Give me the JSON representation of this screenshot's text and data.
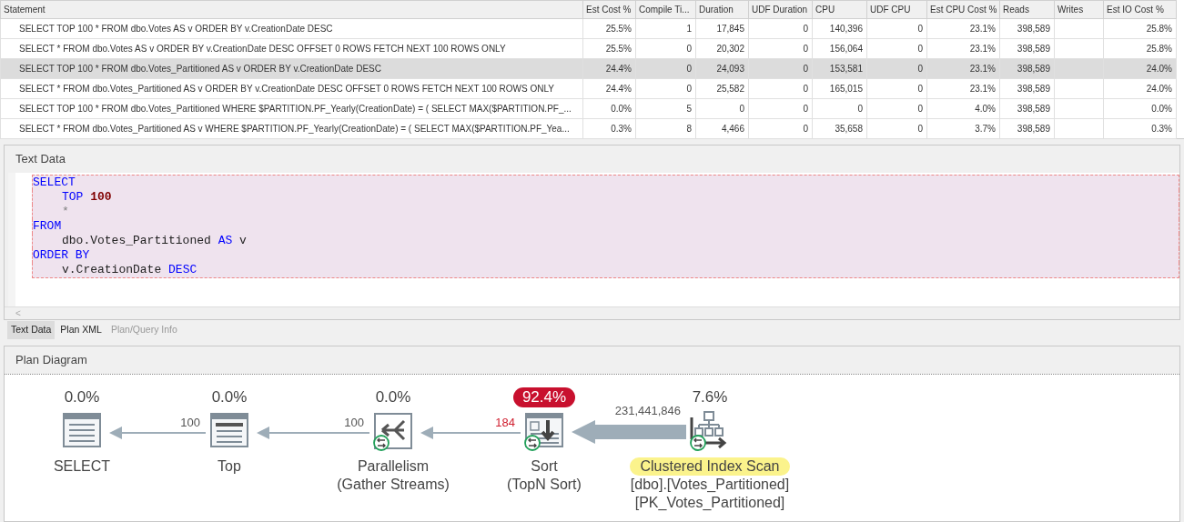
{
  "results_table": {
    "columns": [
      "Statement",
      "Est Cost %",
      "Compile Ti...",
      "Duration",
      "UDF Duration",
      "CPU",
      "UDF CPU",
      "Est CPU Cost %",
      "Reads",
      "Writes",
      "Est IO Cost %"
    ],
    "rows": [
      {
        "selected": false,
        "cells": [
          "SELECT TOP 100 * FROM dbo.Votes AS v ORDER BY v.CreationDate DESC",
          "25.5%",
          "1",
          "17,845",
          "0",
          "140,396",
          "0",
          "23.1%",
          "398,589",
          "",
          "25.8%"
        ]
      },
      {
        "selected": false,
        "cells": [
          "SELECT * FROM dbo.Votes AS v ORDER BY v.CreationDate DESC OFFSET 0 ROWS FETCH NEXT 100 ROWS ONLY",
          "25.5%",
          "0",
          "20,302",
          "0",
          "156,064",
          "0",
          "23.1%",
          "398,589",
          "",
          "25.8%"
        ]
      },
      {
        "selected": true,
        "cells": [
          "SELECT TOP 100 * FROM dbo.Votes_Partitioned AS v ORDER BY v.CreationDate DESC",
          "24.4%",
          "0",
          "24,093",
          "0",
          "153,581",
          "0",
          "23.1%",
          "398,589",
          "",
          "24.0%"
        ]
      },
      {
        "selected": false,
        "cells": [
          "SELECT * FROM dbo.Votes_Partitioned AS v ORDER BY v.CreationDate DESC OFFSET 0 ROWS FETCH NEXT 100 ROWS ONLY",
          "24.4%",
          "0",
          "25,582",
          "0",
          "165,015",
          "0",
          "23.1%",
          "398,589",
          "",
          "24.0%"
        ]
      },
      {
        "selected": false,
        "cells": [
          "SELECT TOP 100 * FROM dbo.Votes_Partitioned WHERE $PARTITION.PF_Yearly(CreationDate) = ( SELECT MAX($PARTITION.PF_...",
          "0.0%",
          "5",
          "0",
          "0",
          "0",
          "0",
          "4.0%",
          "398,589",
          "",
          "0.0%"
        ]
      },
      {
        "selected": false,
        "cells": [
          "SELECT * FROM dbo.Votes_Partitioned AS v WHERE $PARTITION.PF_Yearly(CreationDate) = ( SELECT MAX($PARTITION.PF_Yea...",
          "0.3%",
          "8",
          "4,466",
          "0",
          "35,658",
          "0",
          "3.7%",
          "398,589",
          "",
          "0.3%"
        ]
      }
    ]
  },
  "text_data": {
    "title": "Text Data",
    "lines": [
      {
        "highlighted": true,
        "indented": false,
        "tokens": [
          {
            "kind": "keyword",
            "text": "SELECT"
          }
        ]
      },
      {
        "highlighted": true,
        "indented": true,
        "tokens": [
          {
            "kind": "keyword",
            "text": "TOP"
          },
          {
            "kind": "number",
            "text": "100"
          }
        ]
      },
      {
        "highlighted": true,
        "indented": true,
        "tokens": [
          {
            "kind": "operator",
            "text": "*"
          }
        ]
      },
      {
        "highlighted": true,
        "indented": false,
        "tokens": [
          {
            "kind": "keyword",
            "text": "FROM"
          }
        ]
      },
      {
        "highlighted": true,
        "indented": true,
        "tokens": [
          {
            "kind": "plain",
            "text": "dbo.Votes_Partitioned"
          },
          {
            "kind": "keyword",
            "text": "AS"
          },
          {
            "kind": "plain",
            "text": "v"
          }
        ]
      },
      {
        "highlighted": true,
        "indented": false,
        "tokens": [
          {
            "kind": "keyword",
            "text": "ORDER BY"
          }
        ]
      },
      {
        "highlighted": true,
        "indented": true,
        "tokens": [
          {
            "kind": "plain",
            "text": "v.CreationDate"
          },
          {
            "kind": "keyword",
            "text": "DESC"
          }
        ]
      }
    ],
    "scroll_arrow": "<"
  },
  "tabs": [
    {
      "label": "Text Data",
      "selected": true,
      "disabled": false
    },
    {
      "label": "Plan XML",
      "selected": false,
      "disabled": false
    },
    {
      "label": "Plan/Query Info",
      "selected": false,
      "disabled": true
    }
  ],
  "plan_diagram": {
    "title": "Plan Diagram",
    "nodes": [
      {
        "kind": "select",
        "cost": "0.0%",
        "cost_warning": false,
        "parallel": false,
        "label": "SELECT",
        "label_warning": false
      },
      {
        "kind": "top",
        "cost": "0.0%",
        "cost_warning": false,
        "parallel": false,
        "label": "Top",
        "label_warning": false
      },
      {
        "kind": "parallelism",
        "cost": "0.0%",
        "cost_warning": false,
        "parallel": true,
        "label": "Parallelism",
        "label_warning": false,
        "details": [
          "(Gather Streams)"
        ]
      },
      {
        "kind": "sort",
        "cost": "92.4%",
        "cost_warning": true,
        "parallel": true,
        "label": "Sort",
        "label_warning": false,
        "details": [
          "(TopN Sort)"
        ]
      },
      {
        "kind": "clustered_index_scan",
        "cost": "7.6%",
        "cost_warning": false,
        "parallel": true,
        "label": "Clustered Index Scan",
        "label_warning": true,
        "details": [
          "[dbo].[Votes_Partitioned]",
          "[PK_Votes_Partitioned]"
        ]
      }
    ],
    "edges": [
      {
        "rows": "100",
        "thick": false,
        "warning": false
      },
      {
        "rows": "100",
        "thick": false,
        "warning": false
      },
      {
        "rows": "184",
        "thick": false,
        "warning": true
      },
      {
        "rows": "231,441,846",
        "thick": true,
        "warning": false
      }
    ]
  }
}
